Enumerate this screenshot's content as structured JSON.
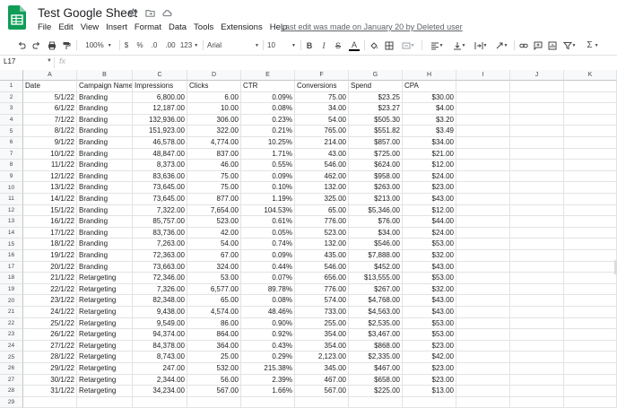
{
  "doc": {
    "title": "Test Google Sheet",
    "last_edit": "Last edit was made on January 20 by Deleted user"
  },
  "menu": [
    "File",
    "Edit",
    "View",
    "Insert",
    "Format",
    "Data",
    "Tools",
    "Extensions",
    "Help"
  ],
  "toolbar": {
    "zoom": "100%",
    "currency": "$",
    "percent": "%",
    "dec_decrease": ".0",
    "dec_increase": ".00",
    "more_formats": "123",
    "font": "Arial",
    "font_size": "10",
    "bold": "B",
    "italic": "I",
    "strike": "S",
    "text_color": "A"
  },
  "formula_bar": {
    "cell_ref": "L17",
    "fx": "fx",
    "value": ""
  },
  "columns": [
    "A",
    "B",
    "C",
    "D",
    "E",
    "F",
    "G",
    "H",
    "I",
    "J",
    "K"
  ],
  "rows": [
    [
      "Date",
      "Campaign Name",
      "Impressions",
      "Clicks",
      "CTR",
      "Conversions",
      "Spend",
      "CPA"
    ],
    [
      "5/1/22",
      "Branding",
      "6,800.00",
      "6.00",
      "0.09%",
      "75.00",
      "$23.25",
      "$30.00"
    ],
    [
      "6/1/22",
      "Branding",
      "12,187.00",
      "10.00",
      "0.08%",
      "34.00",
      "$23.27",
      "$4.00"
    ],
    [
      "7/1/22",
      "Branding",
      "132,936.00",
      "306.00",
      "0.23%",
      "54.00",
      "$505.30",
      "$3.20"
    ],
    [
      "8/1/22",
      "Branding",
      "151,923.00",
      "322.00",
      "0.21%",
      "765.00",
      "$551.82",
      "$3.49"
    ],
    [
      "9/1/22",
      "Branding",
      "46,578.00",
      "4,774.00",
      "10.25%",
      "214.00",
      "$857.00",
      "$34.00"
    ],
    [
      "10/1/22",
      "Branding",
      "48,847.00",
      "837.00",
      "1.71%",
      "43.00",
      "$725.00",
      "$21.00"
    ],
    [
      "11/1/22",
      "Branding",
      "8,373.00",
      "46.00",
      "0.55%",
      "546.00",
      "$624.00",
      "$12.00"
    ],
    [
      "12/1/22",
      "Branding",
      "83,636.00",
      "75.00",
      "0.09%",
      "462.00",
      "$958.00",
      "$24.00"
    ],
    [
      "13/1/22",
      "Branding",
      "73,645.00",
      "75.00",
      "0.10%",
      "132.00",
      "$263.00",
      "$23.00"
    ],
    [
      "14/1/22",
      "Branding",
      "73,645.00",
      "877.00",
      "1.19%",
      "325.00",
      "$213.00",
      "$43.00"
    ],
    [
      "15/1/22",
      "Branding",
      "7,322.00",
      "7,654.00",
      "104.53%",
      "65.00",
      "$5,346.00",
      "$12.00"
    ],
    [
      "16/1/22",
      "Branding",
      "85,757.00",
      "523.00",
      "0.61%",
      "776.00",
      "$76.00",
      "$44.00"
    ],
    [
      "17/1/22",
      "Branding",
      "83,736.00",
      "42.00",
      "0.05%",
      "523.00",
      "$34.00",
      "$24.00"
    ],
    [
      "18/1/22",
      "Branding",
      "7,263.00",
      "54.00",
      "0.74%",
      "132.00",
      "$546.00",
      "$53.00"
    ],
    [
      "19/1/22",
      "Branding",
      "72,363.00",
      "67.00",
      "0.09%",
      "435.00",
      "$7,888.00",
      "$32.00"
    ],
    [
      "20/1/22",
      "Branding",
      "73,663.00",
      "324.00",
      "0.44%",
      "546.00",
      "$452.00",
      "$43.00"
    ],
    [
      "21/1/22",
      "Retargeting",
      "72,346.00",
      "53.00",
      "0.07%",
      "656.00",
      "$13,555.00",
      "$53.00"
    ],
    [
      "22/1/22",
      "Retargeting",
      "7,326.00",
      "6,577.00",
      "89.78%",
      "776.00",
      "$267.00",
      "$32.00"
    ],
    [
      "23/1/22",
      "Retargeting",
      "82,348.00",
      "65.00",
      "0.08%",
      "574.00",
      "$4,768.00",
      "$43.00"
    ],
    [
      "24/1/22",
      "Retargeting",
      "9,438.00",
      "4,574.00",
      "48.46%",
      "733.00",
      "$4,563.00",
      "$43.00"
    ],
    [
      "25/1/22",
      "Retargeting",
      "9,549.00",
      "86.00",
      "0.90%",
      "255.00",
      "$2,535.00",
      "$53.00"
    ],
    [
      "26/1/22",
      "Retargeting",
      "94,374.00",
      "864.00",
      "0.92%",
      "354.00",
      "$3,467.00",
      "$53.00"
    ],
    [
      "27/1/22",
      "Retargeting",
      "84,378.00",
      "364.00",
      "0.43%",
      "354.00",
      "$868.00",
      "$23.00"
    ],
    [
      "28/1/22",
      "Retargeting",
      "8,743.00",
      "25.00",
      "0.29%",
      "2,123.00",
      "$2,335.00",
      "$42.00"
    ],
    [
      "29/1/22",
      "Retargeting",
      "247.00",
      "532.00",
      "215.38%",
      "345.00",
      "$467.00",
      "$23.00"
    ],
    [
      "30/1/22",
      "Retargeting",
      "2,344.00",
      "56.00",
      "2.39%",
      "467.00",
      "$658.00",
      "$23.00"
    ],
    [
      "31/1/22",
      "Retargeting",
      "34,234.00",
      "567.00",
      "1.66%",
      "567.00",
      "$225.00",
      "$13.00"
    ],
    [
      "",
      "",
      "",
      "",
      "",
      "",
      "",
      ""
    ]
  ],
  "colors": {
    "sheets_green": "#0f9d58",
    "header_bg": "#f8f9fa",
    "grid": "#e2e3e3"
  }
}
